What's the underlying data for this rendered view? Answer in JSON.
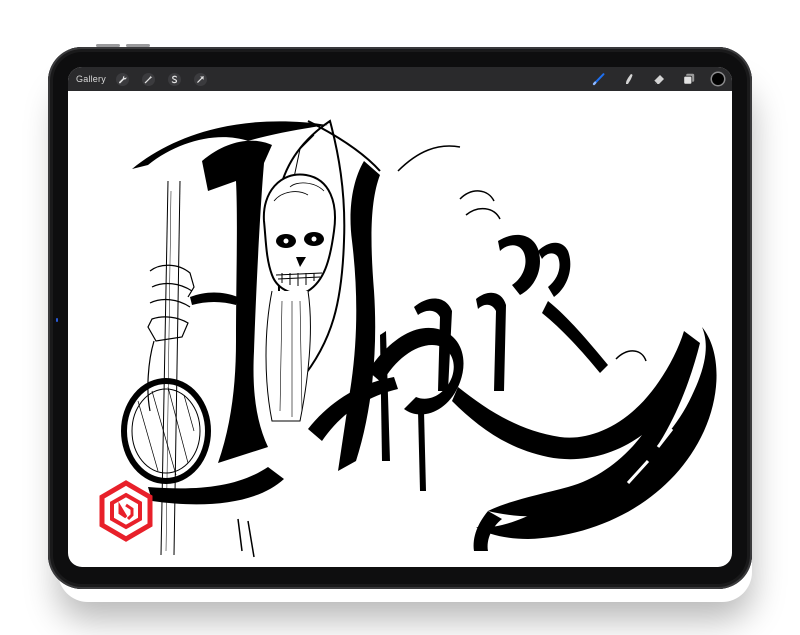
{
  "toolbar": {
    "gallery_label": "Gallery",
    "left_tools": [
      "wrench-icon",
      "magic-wand-icon",
      "selection-icon",
      "transform-arrow-icon"
    ],
    "right_tools": [
      "brush-icon",
      "smudge-icon",
      "eraser-icon",
      "layers-icon"
    ],
    "active_tool": "brush-icon",
    "active_color": "#1e6ff0",
    "current_color": "#000000"
  },
  "artwork": {
    "subject": "grim-reaper-calligraphy",
    "ink_color": "#000000",
    "logo_color": "#e8202a"
  }
}
